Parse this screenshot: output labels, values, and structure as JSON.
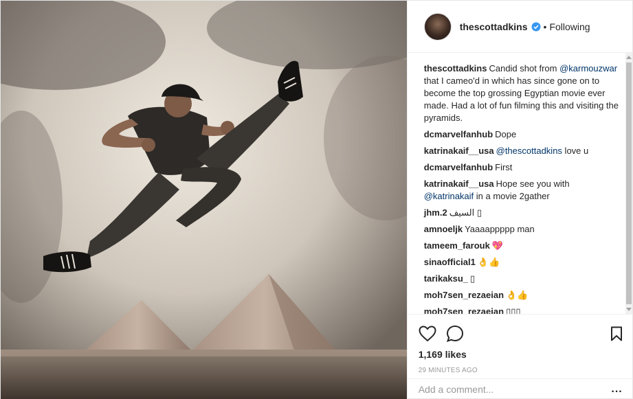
{
  "post": {
    "image_alt": "photo-of-jump-kick-at-pyramids"
  },
  "header": {
    "username": "thescottadkins",
    "separator": "•",
    "follow_status": "Following",
    "verified_color": "#3897f0"
  },
  "comments": [
    {
      "user": "thescottadkins",
      "parts": [
        {
          "text": "Candid shot from ",
          "mention": false
        },
        {
          "text": "@karmouzwar",
          "mention": true
        },
        {
          "text": " that I cameo'd in which has since gone on to become the top grossing Egyptian movie ever made. Had a lot of fun filming this and visiting the pyramids.",
          "mention": false
        }
      ]
    },
    {
      "user": "dcmarvelfanhub",
      "parts": [
        {
          "text": "Dope",
          "mention": false
        }
      ]
    },
    {
      "user": "katrinakaif__usa",
      "parts": [
        {
          "text": "@thescottadkins",
          "mention": true
        },
        {
          "text": " love u",
          "mention": false
        }
      ]
    },
    {
      "user": "dcmarvelfanhub",
      "parts": [
        {
          "text": "First",
          "mention": false
        }
      ]
    },
    {
      "user": "katrinakaif__usa",
      "parts": [
        {
          "text": "Hope see you with ",
          "mention": false
        },
        {
          "text": "@katrinakaif",
          "mention": true
        },
        {
          "text": " in a movie 2gather",
          "mention": false
        }
      ]
    },
    {
      "user": "jhm.2",
      "parts": [
        {
          "text": "السيف ▯",
          "mention": false
        }
      ]
    },
    {
      "user": "amnoeljk",
      "parts": [
        {
          "text": "Yaaaappppp man",
          "mention": false
        }
      ]
    },
    {
      "user": "tameem_farouk",
      "parts": [
        {
          "text": "💖",
          "mention": false
        }
      ]
    },
    {
      "user": "sinaofficial1",
      "parts": [
        {
          "text": "👌👍",
          "mention": false
        }
      ]
    },
    {
      "user": "tarikaksu_",
      "parts": [
        {
          "text": "▯",
          "mention": false
        }
      ]
    },
    {
      "user": "moh7sen_rezaeian",
      "parts": [
        {
          "text": "👌👍",
          "mention": false
        }
      ]
    },
    {
      "user": "moh7sen_rezaeian",
      "parts": [
        {
          "text": "▯▯▯",
          "mention": false
        }
      ]
    }
  ],
  "actions": {
    "like_icon": "heart-icon",
    "comment_icon": "comment-icon",
    "save_icon": "bookmark-icon",
    "likes": "1,169 likes",
    "time": "29 MINUTES AGO"
  },
  "add_comment": {
    "placeholder": "Add a comment...",
    "more": "..."
  }
}
